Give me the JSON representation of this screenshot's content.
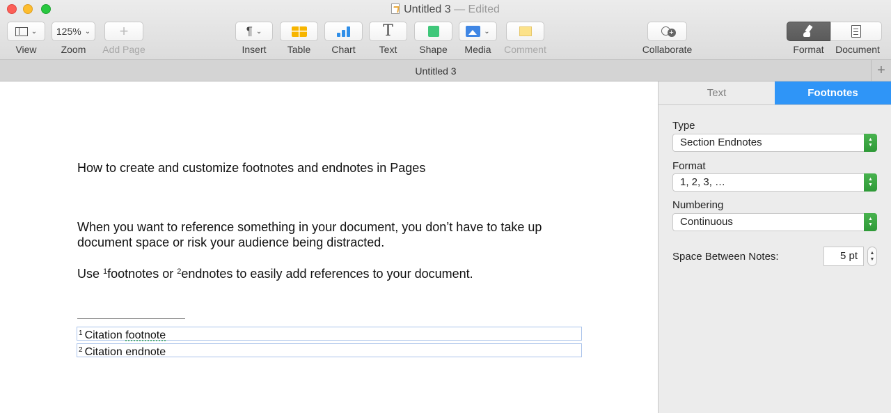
{
  "window": {
    "title": "Untitled 3",
    "status": "— Edited"
  },
  "toolbar": {
    "view_label": "View",
    "zoom_value": "125%",
    "zoom_label": "Zoom",
    "add_page_label": "Add Page",
    "insert_label": "Insert",
    "table_label": "Table",
    "chart_label": "Chart",
    "text_label": "Text",
    "shape_label": "Shape",
    "media_label": "Media",
    "comment_label": "Comment",
    "collaborate_label": "Collaborate",
    "format_label": "Format",
    "document_label": "Document"
  },
  "tabbar": {
    "title": "Untitled 3",
    "add_symbol": "+"
  },
  "document": {
    "heading": "How to create and customize footnotes and endnotes in Pages",
    "paragraph1": "When you want to reference something in your document, you don’t have to take up document space or risk your audience being distracted.",
    "paragraph2": {
      "prefix": "Use ",
      "ref1": "1",
      "word1": "footnotes",
      "middle": " or ",
      "ref2": "2",
      "word2": "endnotes",
      "suffix": " to easily add references to your document."
    },
    "notes": [
      {
        "number": "1",
        "text_a": "Citation ",
        "text_b": "footnote"
      },
      {
        "number": "2",
        "text_a": "Citation endnote",
        "text_b": ""
      }
    ]
  },
  "inspector": {
    "tabs": [
      {
        "label": "Text",
        "active": false
      },
      {
        "label": "Footnotes",
        "active": true
      }
    ],
    "type_label": "Type",
    "type_value": "Section Endnotes",
    "format_label": "Format",
    "format_value": "1, 2, 3, …",
    "numbering_label": "Numbering",
    "numbering_value": "Continuous",
    "spacing_label": "Space Between Notes:",
    "spacing_value": "5 pt"
  },
  "colors": {
    "accent": "#2f95f7",
    "stepper_green": "#3aa343",
    "close": "#fc5f57",
    "minimize": "#fdbd2e",
    "maximize": "#28c840"
  }
}
